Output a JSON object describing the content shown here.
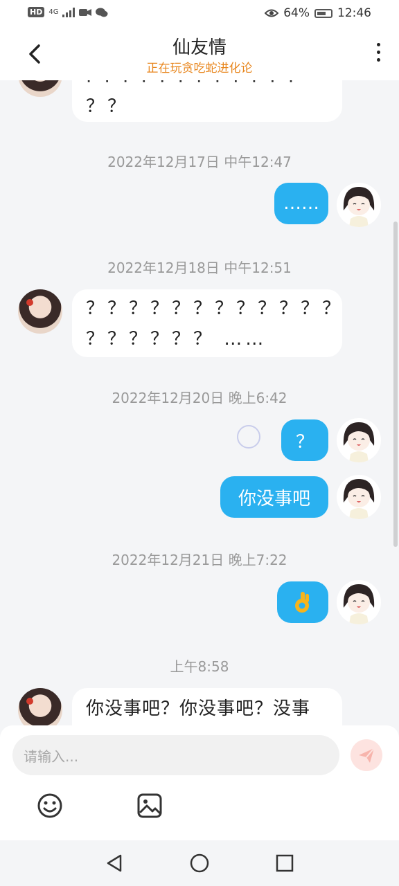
{
  "status": {
    "hd": "HD",
    "network": "4G",
    "battery": "64%",
    "time": "12:46"
  },
  "header": {
    "title": "仙友情",
    "subtitle": "正在玩贪吃蛇进化论"
  },
  "messages": {
    "m0_line1": "· · · · · · · · · · · ·",
    "m0_line2": "？？",
    "ts1": "2022年12月17日 中午12:47",
    "m1": "……",
    "ts2": "2022年12月18日 中午12:51",
    "m2_line1": "？？？？？？？？？？？？",
    "m2_line2": "？？？？？？ ……",
    "ts3": "2022年12月20日 晚上6:42",
    "m3": "？",
    "m4": "你没事吧",
    "ts4": "2022年12月21日 晚上7:22",
    "m5_emoji": "ok-hand",
    "ts5": "上午8:58",
    "m6": "你没事吧？你没事吧？没事"
  },
  "input": {
    "placeholder": "请输入..."
  },
  "icons": {
    "back": "back-arrow-icon",
    "more": "more-vertical-icon",
    "send": "send-icon",
    "emoji": "emoji-icon",
    "image": "image-icon",
    "nav_back": "nav-back-icon",
    "nav_home": "nav-home-icon",
    "nav_recent": "nav-recent-icon"
  },
  "colors": {
    "accent": "#2ab1f0",
    "subtitle": "#e8861d",
    "send_disabled": "#fde3e0"
  }
}
